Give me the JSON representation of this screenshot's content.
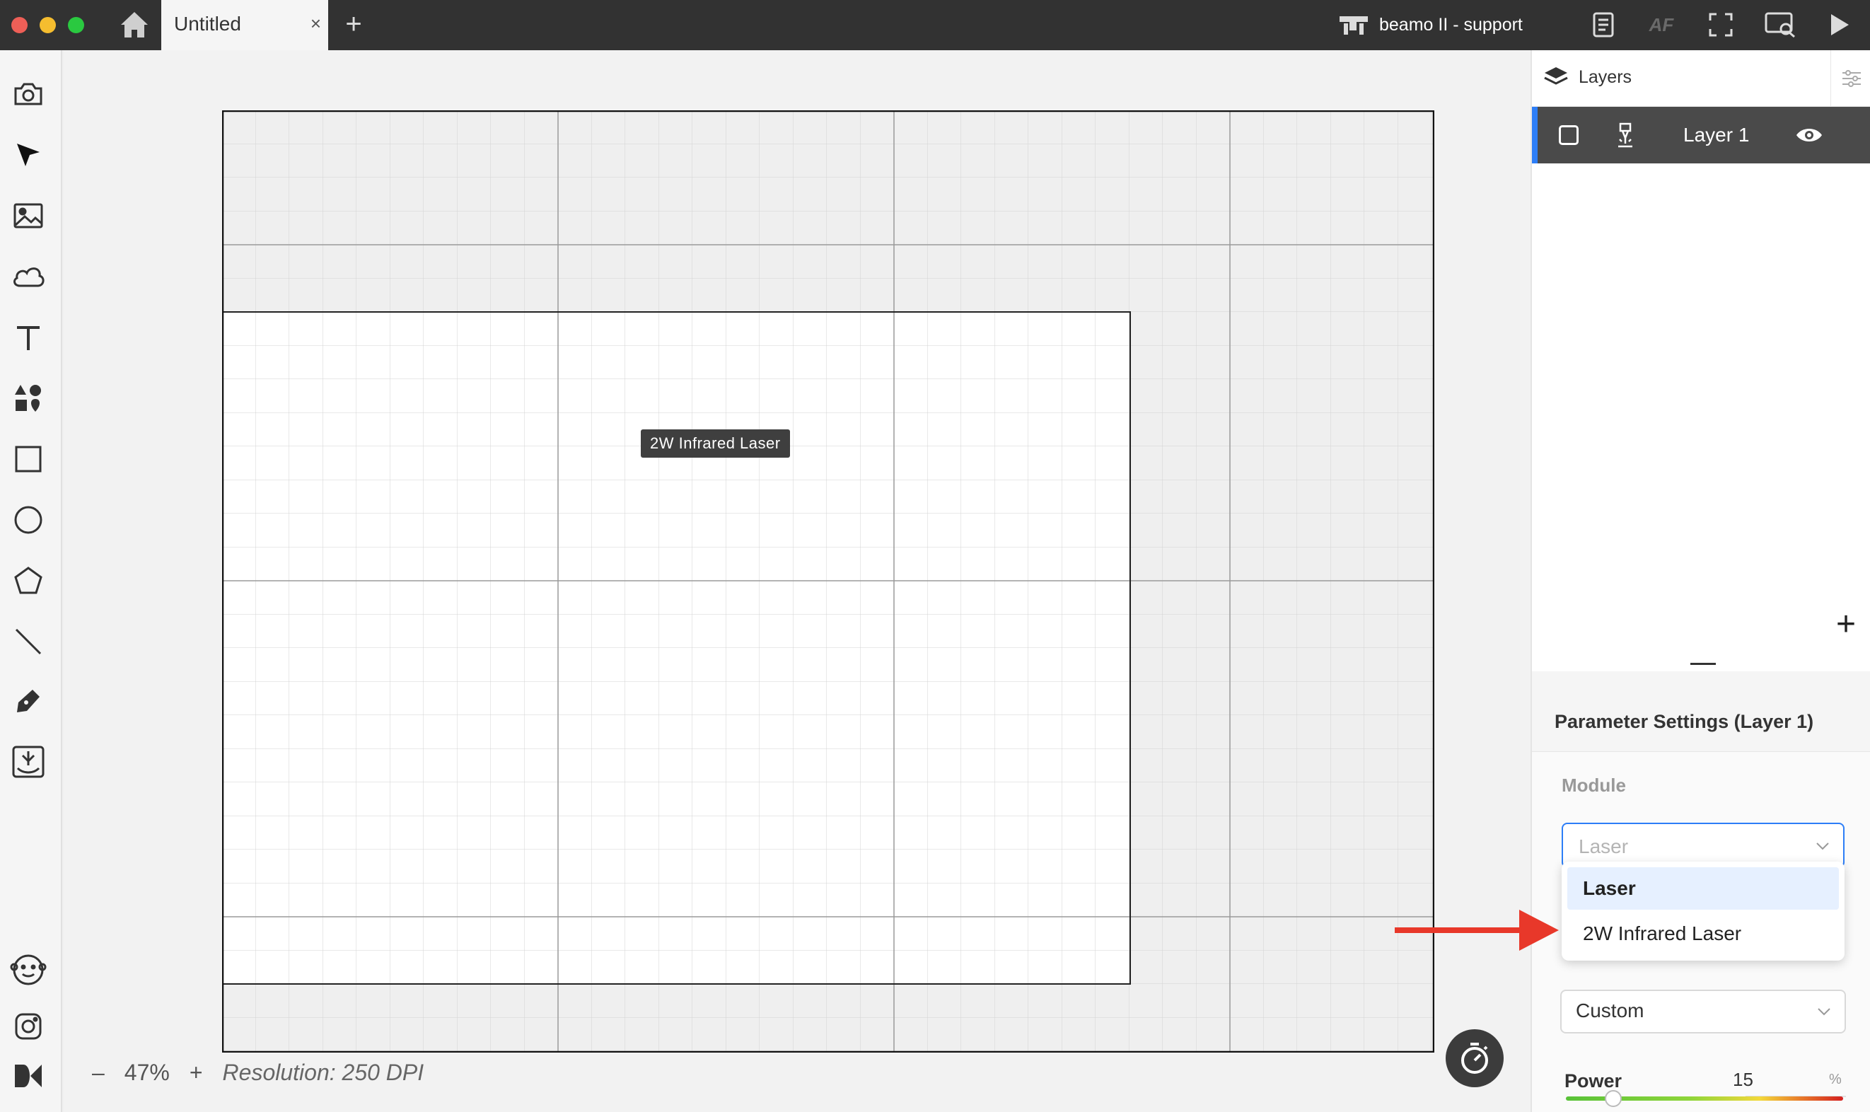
{
  "window": {
    "tab_title": "Untitled",
    "tab_close": "×",
    "tab_add": "+",
    "device_name": "beamo II - support",
    "af_label": "AF"
  },
  "canvas": {
    "zoom_minus": "–",
    "zoom_level": "47%",
    "zoom_plus": "+",
    "resolution": "Resolution: 250 DPI",
    "tooltip": "2W Infrared Laser"
  },
  "layers": {
    "title": "Layers",
    "items": [
      {
        "name": "Layer 1",
        "visible": true
      }
    ],
    "add": "+"
  },
  "params": {
    "title": "Parameter Settings (Layer 1)",
    "module_label": "Module",
    "module_placeholder": "Laser",
    "module_options": [
      "Laser",
      "2W Infrared Laser"
    ],
    "module_highlighted": "Laser",
    "preset_value": "Custom",
    "power_label": "Power",
    "power_value": "15",
    "power_unit": "%",
    "power_percent": 15
  },
  "colors": {
    "accent": "#2d7ef7",
    "titlebar": "#323232",
    "annotation_arrow": "#e8382a"
  },
  "icons": [
    "home-icon",
    "camera-icon",
    "select-arrow-icon",
    "image-icon",
    "cloud-icon",
    "text-icon",
    "elements-icon",
    "rectangle-icon",
    "ellipse-icon",
    "polygon-icon",
    "line-icon",
    "pen-icon",
    "curve-engrave-icon",
    "beamy-icon",
    "instagram-icon",
    "design-market-icon",
    "timer-icon"
  ]
}
